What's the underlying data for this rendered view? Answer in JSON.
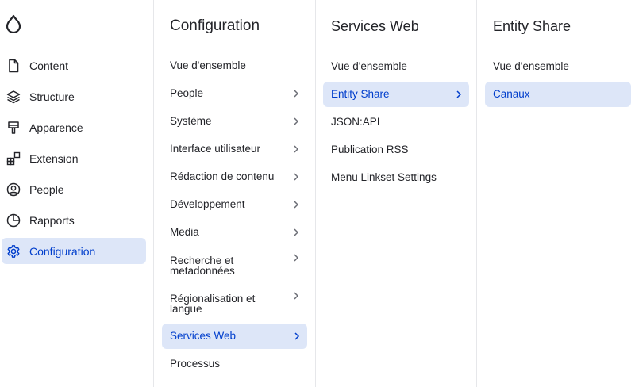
{
  "sidebar": {
    "items": [
      {
        "label": "Content"
      },
      {
        "label": "Structure"
      },
      {
        "label": "Apparence"
      },
      {
        "label": "Extension"
      },
      {
        "label": "People"
      },
      {
        "label": "Rapports"
      },
      {
        "label": "Configuration"
      }
    ]
  },
  "col1": {
    "title": "Configuration",
    "items": [
      {
        "label": "Vue d'ensemble"
      },
      {
        "label": "People"
      },
      {
        "label": "Système"
      },
      {
        "label": "Interface utilisateur"
      },
      {
        "label": "Rédaction de contenu"
      },
      {
        "label": "Développement"
      },
      {
        "label": "Media"
      },
      {
        "label": "Recherche et metadonnées"
      },
      {
        "label": "Régionalisation et langue"
      },
      {
        "label": "Services Web"
      },
      {
        "label": "Processus"
      }
    ]
  },
  "col2": {
    "title": "Services Web",
    "items": [
      {
        "label": "Vue d'ensemble"
      },
      {
        "label": "Entity Share"
      },
      {
        "label": "JSON:API"
      },
      {
        "label": "Publication RSS"
      },
      {
        "label": "Menu Linkset Settings"
      }
    ]
  },
  "col3": {
    "title": "Entity Share",
    "items": [
      {
        "label": "Vue d'ensemble"
      },
      {
        "label": "Canaux"
      }
    ]
  },
  "colors": {
    "active_bg": "#dde6f8",
    "active_text": "#003ecc",
    "border": "#e6e7ea"
  }
}
